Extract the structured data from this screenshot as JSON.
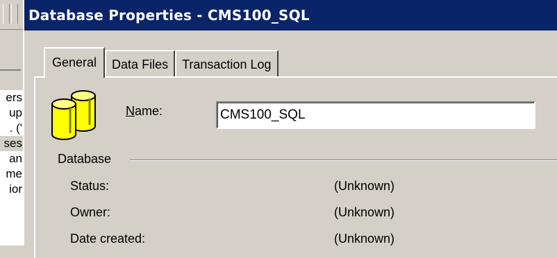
{
  "background_window": {
    "list_items": [
      "ers",
      "up",
      ". ('",
      "ses",
      "an",
      "me",
      "ior"
    ]
  },
  "dialog": {
    "title": "Database Properties - CMS100_SQL",
    "tabs": [
      {
        "label": "General",
        "active": true
      },
      {
        "label": "Data Files",
        "active": false
      },
      {
        "label": "Transaction Log",
        "active": false
      }
    ],
    "name_label": "Name:",
    "name_label_mnemonic": "N",
    "name_label_rest": "ame:",
    "name_value": "CMS100_SQL",
    "group_label": "Database",
    "properties": [
      {
        "label": "Status:",
        "value": "(Unknown)"
      },
      {
        "label": "Owner:",
        "value": "(Unknown)"
      },
      {
        "label": "Date created:",
        "value": "(Unknown)"
      }
    ],
    "icon": "database-icon",
    "colors": {
      "titlebar": "#0a246a",
      "face": "#d4d0c8",
      "icon_fill": "#ffff00"
    }
  }
}
